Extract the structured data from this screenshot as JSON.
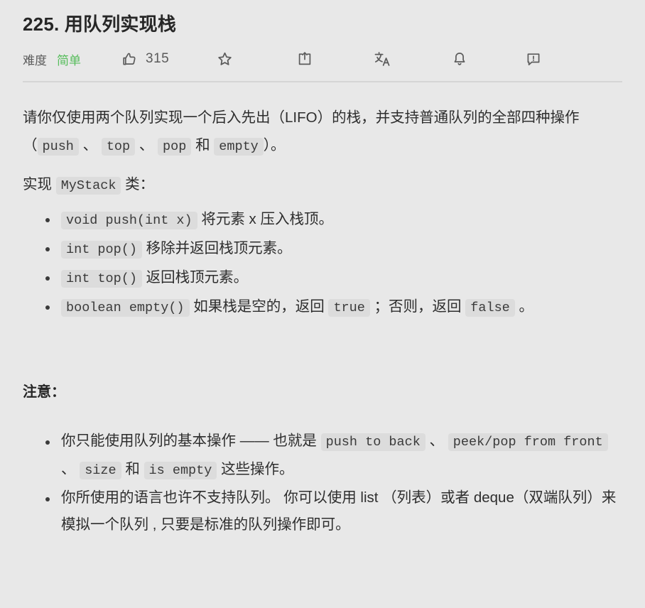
{
  "header": {
    "title": "225. 用队列实现栈",
    "difficulty_label": "难度",
    "difficulty_value": "简单",
    "difficulty_color": "#56bd5b",
    "vote_count": "315",
    "icons": {
      "thumbs_up": "thumbs-up-icon",
      "star": "star-icon",
      "share": "share-icon",
      "translate": "translate-icon",
      "bell": "bell-icon",
      "feedback": "feedback-icon"
    }
  },
  "description": {
    "p1_a": "请你仅使用两个队列实现一个后入先出（LIFO）的栈，并支持普通队列的全部四种操作（",
    "p1_code1": "push",
    "p1_b": "、",
    "p1_code2": "top",
    "p1_c": "、",
    "p1_code3": "pop",
    "p1_d": "和",
    "p1_code4": "empty",
    "p1_e": "）。",
    "p2_a": "实现",
    "p2_code": "MyStack",
    "p2_b": "类："
  },
  "methods": [
    {
      "code": "void push(int x)",
      "text": "将元素 x 压入栈顶。"
    },
    {
      "code": "int pop()",
      "text": "移除并返回栈顶元素。"
    },
    {
      "code": "int top()",
      "text": "返回栈顶元素。"
    },
    {
      "code": "boolean empty()",
      "text": "如果栈是空的，返回",
      "code2": "true",
      "text2": "；否则，返回",
      "code3": "false",
      "text3": "。"
    }
  ],
  "notes": {
    "heading": "注意：",
    "items": [
      {
        "a": "你只能使用队列的基本操作 —— 也就是",
        "code1": "push to back",
        "b": "、",
        "code2": "peek/pop from front",
        "c": "、",
        "code3": "size",
        "d": "和",
        "code4": "is empty",
        "e": "这些操作。"
      },
      {
        "a": "你所使用的语言也许不支持队列。 你可以使用 list （列表）或者 deque（双端队列）来模拟一个队列 , 只要是标准的队列操作即可。"
      }
    ]
  },
  "colors": {
    "background": "#e8e8e8",
    "code_chip": "#dcdcdc",
    "divider": "#d5d5d5",
    "text": "#2e2e2e",
    "muted": "#5b5b5b"
  }
}
